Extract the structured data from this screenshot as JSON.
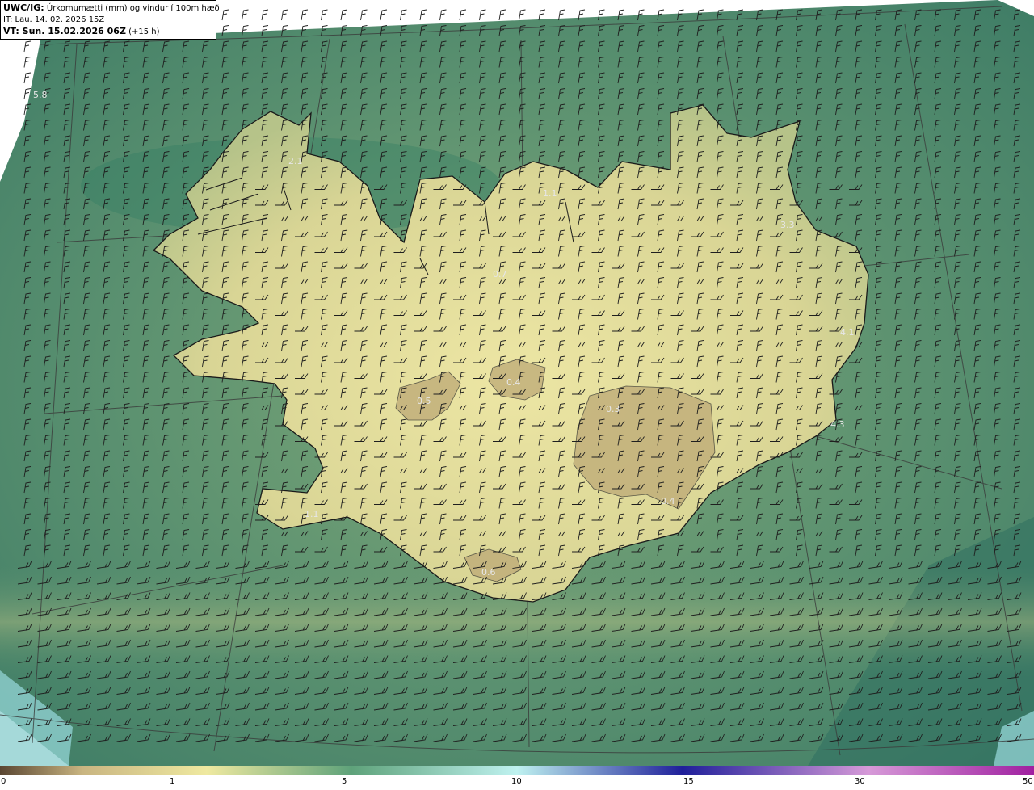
{
  "header": {
    "product": "UWC/IG:",
    "title": "Úrkomumætti (mm) og vindur í 100m hæð",
    "issue_time": "IT: Lau. 14. 02. 2026 15Z",
    "valid_bold": "VT: Sun. 15.02.2026 06Z",
    "valid_offset": "(+15 h)"
  },
  "map_labels": [
    "5.8",
    "2.1",
    "1.1",
    "3.3",
    "0.7",
    "4.1",
    "0.4",
    "0.5",
    "0.3",
    "4.3",
    "0.4",
    "1.1",
    "0.6"
  ],
  "colorbar": {
    "ticks": [
      "0",
      "1",
      "5",
      "10",
      "15",
      "30",
      "50"
    ],
    "colors": [
      "#5a4632",
      "#c9b581",
      "#efe9a0",
      "#5ea27a",
      "#bff2f0",
      "#1f1f9a",
      "#d69ad8",
      "#a020a0"
    ]
  },
  "colors": {
    "sea": "#4e8a6c",
    "land_low": "#e8df9a",
    "land_dry": "#bda976",
    "coast": "#1a1a1a"
  }
}
